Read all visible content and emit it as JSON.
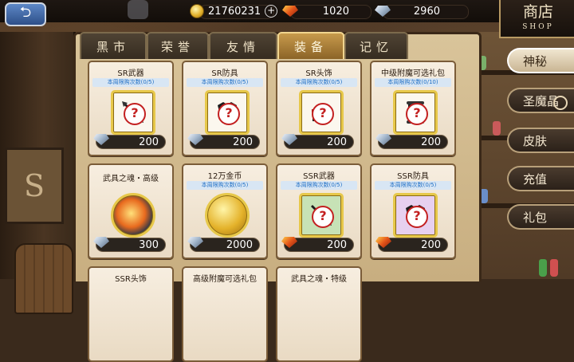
{
  "header": {
    "back_icon": "back-arrow-icon",
    "gold": "21760231",
    "red_gems": "1020",
    "blue_crystals": "2960"
  },
  "shop_title": {
    "cn": "商店",
    "en": "SHOP"
  },
  "tabs": [
    {
      "label": "黑市",
      "active": false
    },
    {
      "label": "荣誉",
      "active": false
    },
    {
      "label": "友情",
      "active": false
    },
    {
      "label": "装备",
      "active": true
    },
    {
      "label": "记忆",
      "active": false
    }
  ],
  "items": [
    {
      "name": "SR武器",
      "limit": "本周限购次数(0/5)",
      "price": "200",
      "currency": "blue-crystal",
      "icon": "sword-unknown-icon"
    },
    {
      "name": "SR防具",
      "limit": "本周限购次数(0/5)",
      "price": "200",
      "currency": "blue-crystal",
      "icon": "armor-unknown-icon"
    },
    {
      "name": "SR头饰",
      "limit": "本周限购次数(0/5)",
      "price": "200",
      "currency": "blue-crystal",
      "icon": "helmet-unknown-icon"
    },
    {
      "name": "中级附魔可选礼包",
      "limit": "本周限购次数(0/10)",
      "price": "200",
      "currency": "blue-crystal",
      "icon": "scroll-unknown-icon"
    },
    {
      "name": "武具之魂・高级",
      "limit": "",
      "price": "300",
      "currency": "blue-crystal",
      "icon": "soul-orb-icon"
    },
    {
      "name": "12万金币",
      "limit": "本周限购次数(0/5)",
      "price": "2000",
      "currency": "blue-crystal",
      "icon": "gold-coins-icon"
    },
    {
      "name": "SSR武器",
      "limit": "本周限购次数(0/5)",
      "price": "200",
      "currency": "red-gem",
      "icon": "sword-unknown-icon"
    },
    {
      "name": "SSR防具",
      "limit": "本周限购次数(0/5)",
      "price": "200",
      "currency": "red-gem",
      "icon": "armor-unknown-icon"
    }
  ],
  "next_row_names": [
    "SSR头饰",
    "高级附魔可选礼包",
    "武具之魂・特级"
  ],
  "side_nav": [
    {
      "label": "神秘",
      "active": true
    },
    {
      "label": "圣魔晶",
      "active": false
    },
    {
      "label": "皮肤",
      "active": false
    },
    {
      "label": "充值",
      "active": false
    },
    {
      "label": "礼包",
      "active": false
    }
  ],
  "colors": {
    "panel": "#d9c49a",
    "tab_active": "#c79a4c",
    "limit_text": "#1f6fc5",
    "frame_gold": "#e7c84a"
  }
}
